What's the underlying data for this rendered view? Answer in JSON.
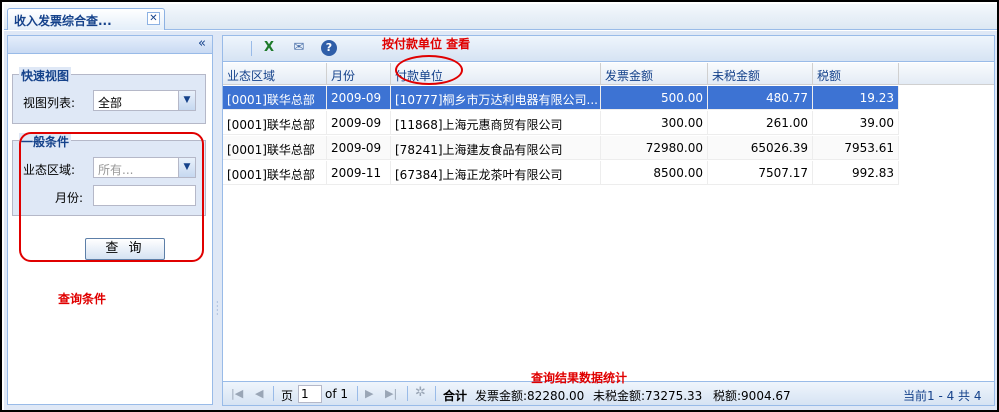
{
  "tab": {
    "title": "收入发票综合查...",
    "close": "✕"
  },
  "left_panel": {
    "collapse": "«",
    "quick_view": {
      "legend": "快速视图",
      "view_list_label": "视图列表:",
      "view_list_value": "全部"
    },
    "general": {
      "legend": "一般条件",
      "region_label": "业态区域:",
      "region_placeholder": "所有...",
      "month_label": "月份:",
      "month_value": ""
    },
    "query_button": "查 询"
  },
  "annotations": {
    "query_conditions": "查询条件",
    "by_payer": "按付款单位  查看",
    "summary": "查询结果数据统计"
  },
  "grid": {
    "columns": [
      "业态区域",
      "月份",
      "付款单位",
      "发票金额",
      "未税金额",
      "税额"
    ],
    "rows": [
      [
        "[0001]联华总部",
        "2009-09",
        "[10777]桐乡市万达利电器有限公司...",
        "500.00",
        "480.77",
        "19.23"
      ],
      [
        "[0001]联华总部",
        "2009-09",
        "[11868]上海元惠商贸有限公司",
        "300.00",
        "261.00",
        "39.00"
      ],
      [
        "[0001]联华总部",
        "2009-09",
        "[78241]上海建友食品有限公司",
        "72980.00",
        "65026.39",
        "7953.61"
      ],
      [
        "[0001]联华总部",
        "2009-11",
        "[67384]上海正龙茶叶有限公司",
        "8500.00",
        "7507.17",
        "992.83"
      ]
    ],
    "selected_row": 0
  },
  "pager": {
    "page_label": "页",
    "page_value": "1",
    "of_label": "of 1",
    "total_label": "合计",
    "invoice_total": "发票金额:82280.00",
    "pretax_total": "未税金额:73275.33",
    "tax_total": "税额:9004.67",
    "range": "当前1 - 4 共 4"
  },
  "toolbar": {
    "icons": [
      "excel-export-icon",
      "email-icon",
      "help-icon"
    ]
  }
}
